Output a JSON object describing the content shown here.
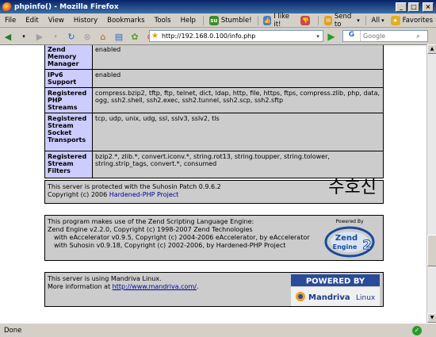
{
  "window": {
    "title": "phpinfo() - Mozilla Firefox"
  },
  "menubar": {
    "items": [
      "File",
      "Edit",
      "View",
      "History",
      "Bookmarks",
      "Tools",
      "Help"
    ],
    "stumble": "Stumble!",
    "like": "I like it!",
    "sendto": "Send to",
    "all": "All",
    "favorites": "Favorites"
  },
  "navbar": {
    "url": "http://192.168.0.100/info.php",
    "search_placeholder": "Google",
    "search_engine": "G"
  },
  "table_rows": [
    {
      "label": "Zend Memory Manager",
      "value": "enabled"
    },
    {
      "label": "IPv6 Support",
      "value": "enabled"
    },
    {
      "label": "Registered PHP Streams",
      "value": "compress.bzip2, tftp, ftp, telnet, dict, ldap, http, file, https, ftps, compress.zlib, php, data, ogg, ssh2.shell, ssh2.exec, ssh2.tunnel, ssh2.scp, ssh2.sftp"
    },
    {
      "label": "Registered Stream Socket Transports",
      "value": "tcp, udp, unix, udg, ssl, sslv3, sslv2, tls"
    },
    {
      "label": "Registered Stream Filters",
      "value": "bzip2.*, zlib.*, convert.iconv.*, string.rot13, string.toupper, string.tolower, string.strip_tags, convert.*, consumed"
    }
  ],
  "suhosin": {
    "line1": "This server is protected with the Suhosin Patch 0.9.6.2",
    "line2_prefix": "Copyright (c) 2006 ",
    "line2_link": "Hardened-PHP Project",
    "logo_text": "수호신"
  },
  "zend": {
    "line1": "This program makes use of the Zend Scripting Language Engine:",
    "line2": "Zend Engine v2.2.0, Copyright (c) 1998-2007 Zend Technologies",
    "line3": "with eAccelerator v0.9.5, Copyright (c) 2004-2006 eAccelerator, by eAccelerator",
    "line4": "with Suhosin v0.9.18, Copyright (c) 2002-2006, by Hardened-PHP Project",
    "logo_powered": "Powered By",
    "logo_zend": "Zend",
    "logo_engine": "Engine",
    "logo_num": "2"
  },
  "mandriva": {
    "line1": "This server is using Mandriva Linux.",
    "line2_prefix": "More information at ",
    "line2_link": "http://www.mandriva.com/",
    "line2_suffix": ".",
    "logo_powered": "POWERED BY",
    "logo_brand": "Mandriva",
    "logo_linux": "Linux"
  },
  "status": {
    "text": "Done"
  },
  "colors": {
    "label_bg": "#ccccff",
    "value_bg": "#cccccc",
    "link": "#000099"
  }
}
